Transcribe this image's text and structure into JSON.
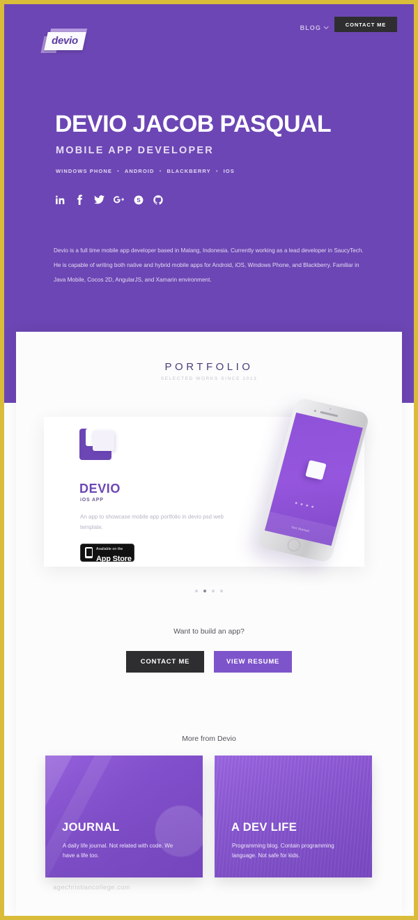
{
  "nav": {
    "logo_text": "devio",
    "blog_label": "BLOG",
    "contact_label": "CONTACT ME"
  },
  "hero": {
    "title": "DEVIO JACOB PASQUAL",
    "subtitle": "MOBILE APP DEVELOPER",
    "tags": [
      "WINDOWS PHONE",
      "ANDROID",
      "BLACKBERRY",
      "IOS"
    ],
    "socials": [
      {
        "name": "linkedin-icon",
        "glyph": "in"
      },
      {
        "name": "facebook-icon",
        "glyph": "f"
      },
      {
        "name": "twitter-icon",
        "glyph": "t"
      },
      {
        "name": "googleplus-icon",
        "glyph": "g+"
      },
      {
        "name": "skype-icon",
        "glyph": "S"
      },
      {
        "name": "github-icon",
        "glyph": "gh"
      }
    ],
    "bio": "Devio is a full time mobile app developer based in Malang, Indonesia. Currently working as a lead developer in SaucyTech. He is capable of writing both native and hybrid mobile apps for Android, iOS, Windows Phone, and Blackberry. Familiar in Java Mobile, Cocos 2D, AngularJS, and Xamarin environment."
  },
  "portfolio": {
    "heading": "PORTFOLIO",
    "subheading": "SELECTED WORKS SINCE 2013",
    "card": {
      "title": "DEVIO",
      "kicker": "iOS APP",
      "description": "An app to showcase mobile app portfolio in devio psd web template.",
      "appstore_small": "Available on the",
      "appstore_big": "App Store"
    },
    "phone_screen_label": "Get Started",
    "carousel": {
      "count": 4,
      "active_index": 1
    }
  },
  "cta": {
    "question": "Want to build an app?",
    "contact_label": "CONTACT ME",
    "resume_label": "VIEW RESUME"
  },
  "more": {
    "heading": "More from Devio",
    "cards": [
      {
        "title": "JOURNAL",
        "description": "A daily life journal. Not related with code. We have a life too."
      },
      {
        "title": "A DEV LIFE",
        "description": "Programming blog. Contain programming language. Not safe for kids."
      }
    ]
  },
  "watermark": "agechristiancollege.com",
  "colors": {
    "purple": "#6c46b4",
    "purple_button": "#7e54cb",
    "dark_button": "#2e2e30",
    "frame": "#d9bc3a"
  }
}
